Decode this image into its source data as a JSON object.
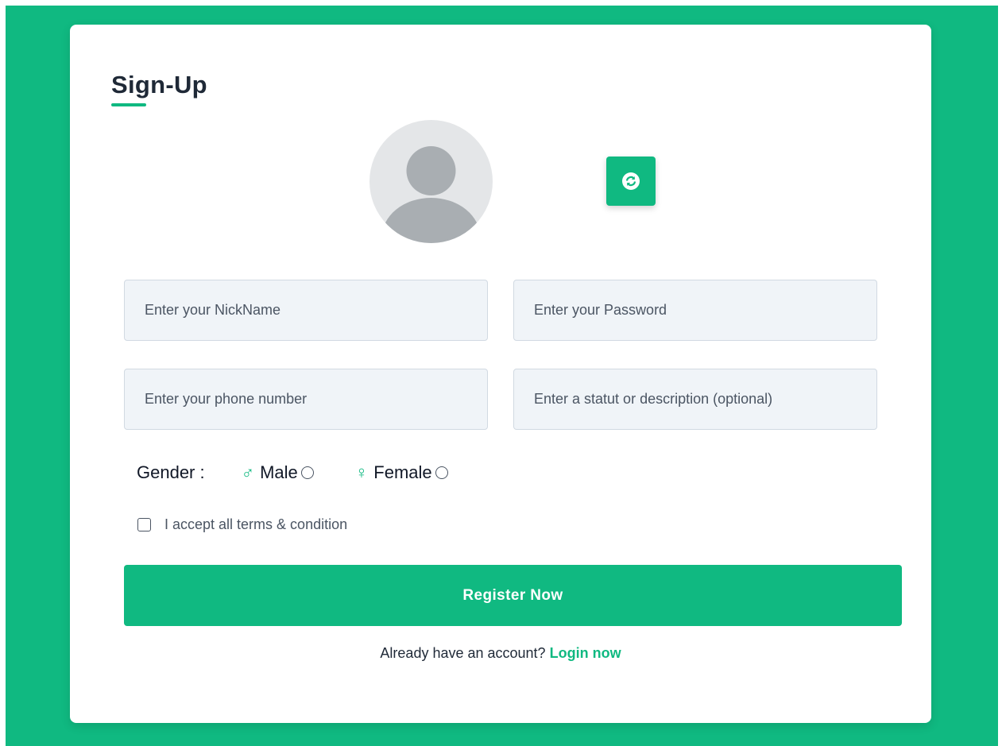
{
  "form": {
    "title": "Sign-Up",
    "avatar_icon": "user-silhouette",
    "refresh_icon": "refresh-icon",
    "nickname_placeholder": "Enter your NickName",
    "password_placeholder": "Enter your Password",
    "phone_placeholder": "Enter your phone number",
    "status_placeholder": "Enter a statut or description (optional)",
    "gender_label": "Gender :",
    "male_label": "Male",
    "female_label": "Female",
    "terms_label": "I accept all terms & condition",
    "register_label": "Register Now",
    "login_prompt": "Already have an account?",
    "login_link": "Login now"
  },
  "colors": {
    "accent": "#10b981",
    "field_bg": "#f0f4f8",
    "avatar_bg": "#e4e6e8",
    "avatar_fg": "#a9aeb2"
  }
}
